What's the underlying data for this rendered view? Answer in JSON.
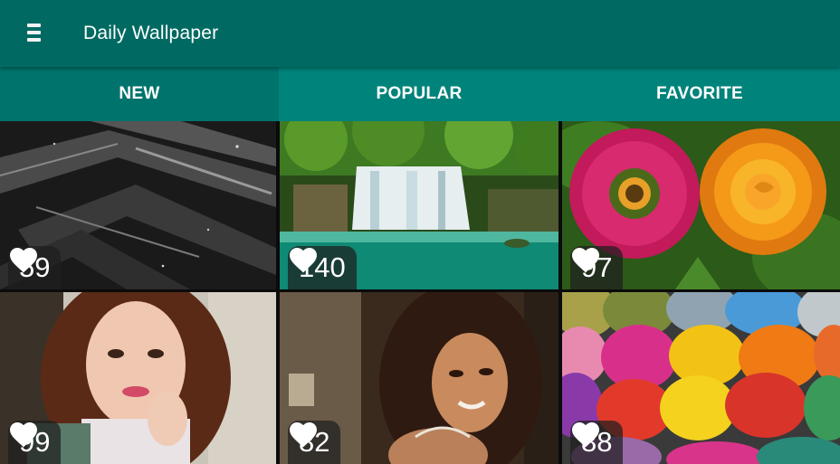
{
  "appbar": {
    "title": "Daily Wallpaper",
    "menu_icon": "hamburger-menu-icon"
  },
  "tabs": [
    {
      "label": "NEW",
      "selected": true
    },
    {
      "label": "POPULAR",
      "selected": false
    },
    {
      "label": "FAVORITE",
      "selected": false
    }
  ],
  "wallpapers": [
    {
      "likes": "59"
    },
    {
      "likes": "140"
    },
    {
      "likes": "97"
    },
    {
      "likes": "99"
    },
    {
      "likes": "82"
    },
    {
      "likes": "88"
    }
  ],
  "colors": {
    "appbar": "#006a62",
    "tabbar": "#00837a",
    "selected_tab": "#00736c",
    "like_badge": "#1e1e1e"
  }
}
